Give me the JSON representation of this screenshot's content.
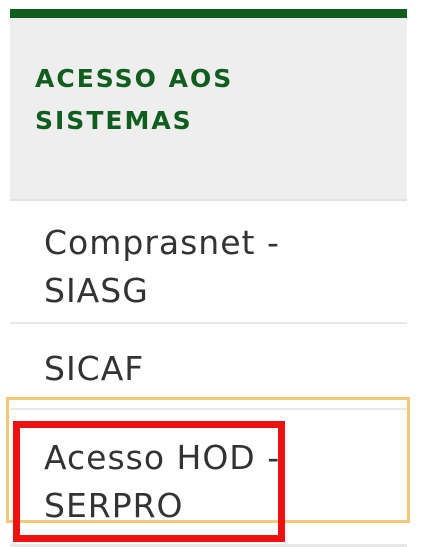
{
  "sidebar": {
    "section_title": "ACESSO AOS\nSISTEMAS",
    "items": [
      {
        "label": "Comprasnet -\nSIASG"
      },
      {
        "label": "SICAF"
      },
      {
        "label": "Acesso HOD -\nSERPRO"
      }
    ],
    "highlighted_item": "Acesso HOD -\nSERPRO"
  },
  "colors": {
    "accent_green": "#0f5e1d",
    "header_bg": "#eeeeee",
    "item_text": "#333333",
    "focus_outline": "#f5c97a",
    "highlight_red": "#ee1111"
  }
}
